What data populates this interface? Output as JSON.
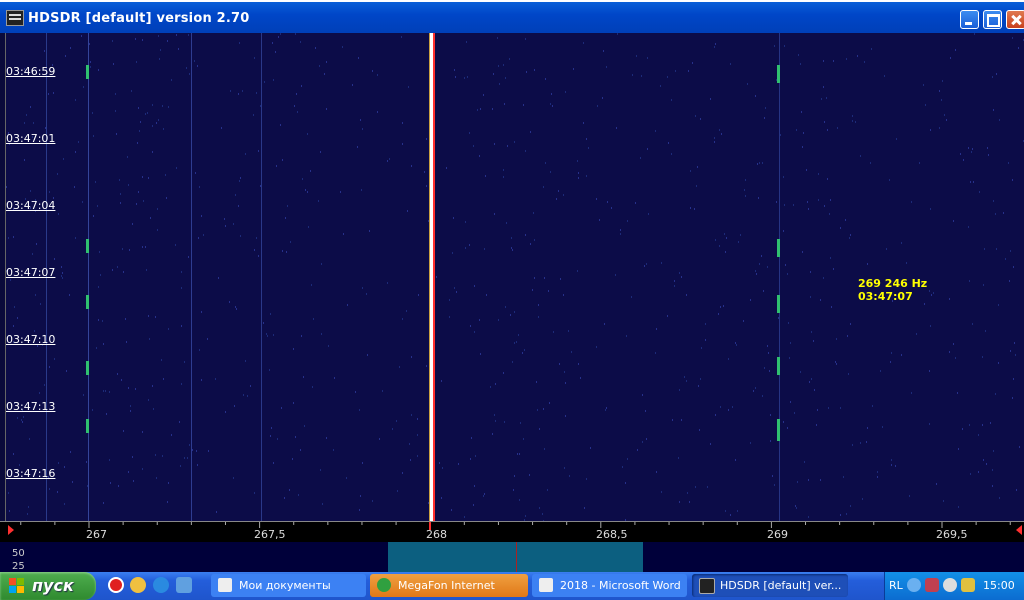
{
  "window": {
    "title": "HDSDR [default]  version 2.70"
  },
  "waterfall": {
    "times": [
      "03:46:59",
      "03:47:01",
      "03:47:04",
      "03:47:07",
      "03:47:10",
      "03:47:13",
      "03:47:16"
    ],
    "cursor": {
      "freq": "269 246 Hz",
      "time": "03:47:07"
    }
  },
  "scale": {
    "labels": [
      "267",
      "267,5",
      "268",
      "268,5",
      "269",
      "269,5"
    ]
  },
  "spectrum": {
    "levels": [
      "50",
      "25"
    ]
  },
  "taskbar": {
    "start_label": "пуск",
    "tasks": [
      {
        "label": "Мои документы"
      },
      {
        "label": "MegaFon Internet"
      },
      {
        "label": "2018 - Microsoft Word"
      },
      {
        "label": "HDSDR [default]  ver..."
      }
    ],
    "tray": {
      "lang": "RL",
      "clock": "15:00"
    }
  },
  "colors": {
    "waterfall_bg": "#0c0c48",
    "signal": "#ffffff",
    "marker": "#ff3030",
    "cursor_text": "#ffff00"
  }
}
